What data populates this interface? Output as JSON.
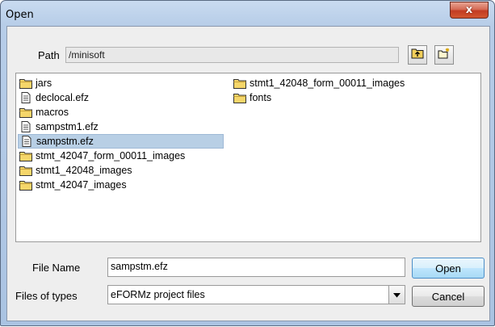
{
  "window": {
    "title": "Open",
    "close_glyph": "x"
  },
  "path": {
    "label": "Path",
    "value": "/minisoft"
  },
  "toolbar": {
    "up_icon": "folder-up-icon",
    "new_folder_icon": "new-folder-icon"
  },
  "files": [
    {
      "name": "jars",
      "type": "folder"
    },
    {
      "name": "declocal.efz",
      "type": "file"
    },
    {
      "name": "macros",
      "type": "folder"
    },
    {
      "name": "sampstm1.efz",
      "type": "file"
    },
    {
      "name": "sampstm.efz",
      "type": "file",
      "selected": true
    },
    {
      "name": "stmt_42047_form_00011_images",
      "type": "folder"
    },
    {
      "name": "stmt1_42048_images",
      "type": "folder"
    },
    {
      "name": "stmt_42047_images",
      "type": "folder"
    },
    {
      "name": "stmt1_42048_form_00011_images",
      "type": "folder"
    },
    {
      "name": "fonts",
      "type": "folder"
    }
  ],
  "file_name": {
    "label": "File Name",
    "value": "sampstm.efz"
  },
  "file_types": {
    "label": "Files of types",
    "value": "eFORMz project files"
  },
  "buttons": {
    "open": "Open",
    "cancel": "Cancel"
  },
  "colors": {
    "selection": "#b8cfe5",
    "folder": "#f5d66a",
    "close_button": "#c94a30"
  }
}
